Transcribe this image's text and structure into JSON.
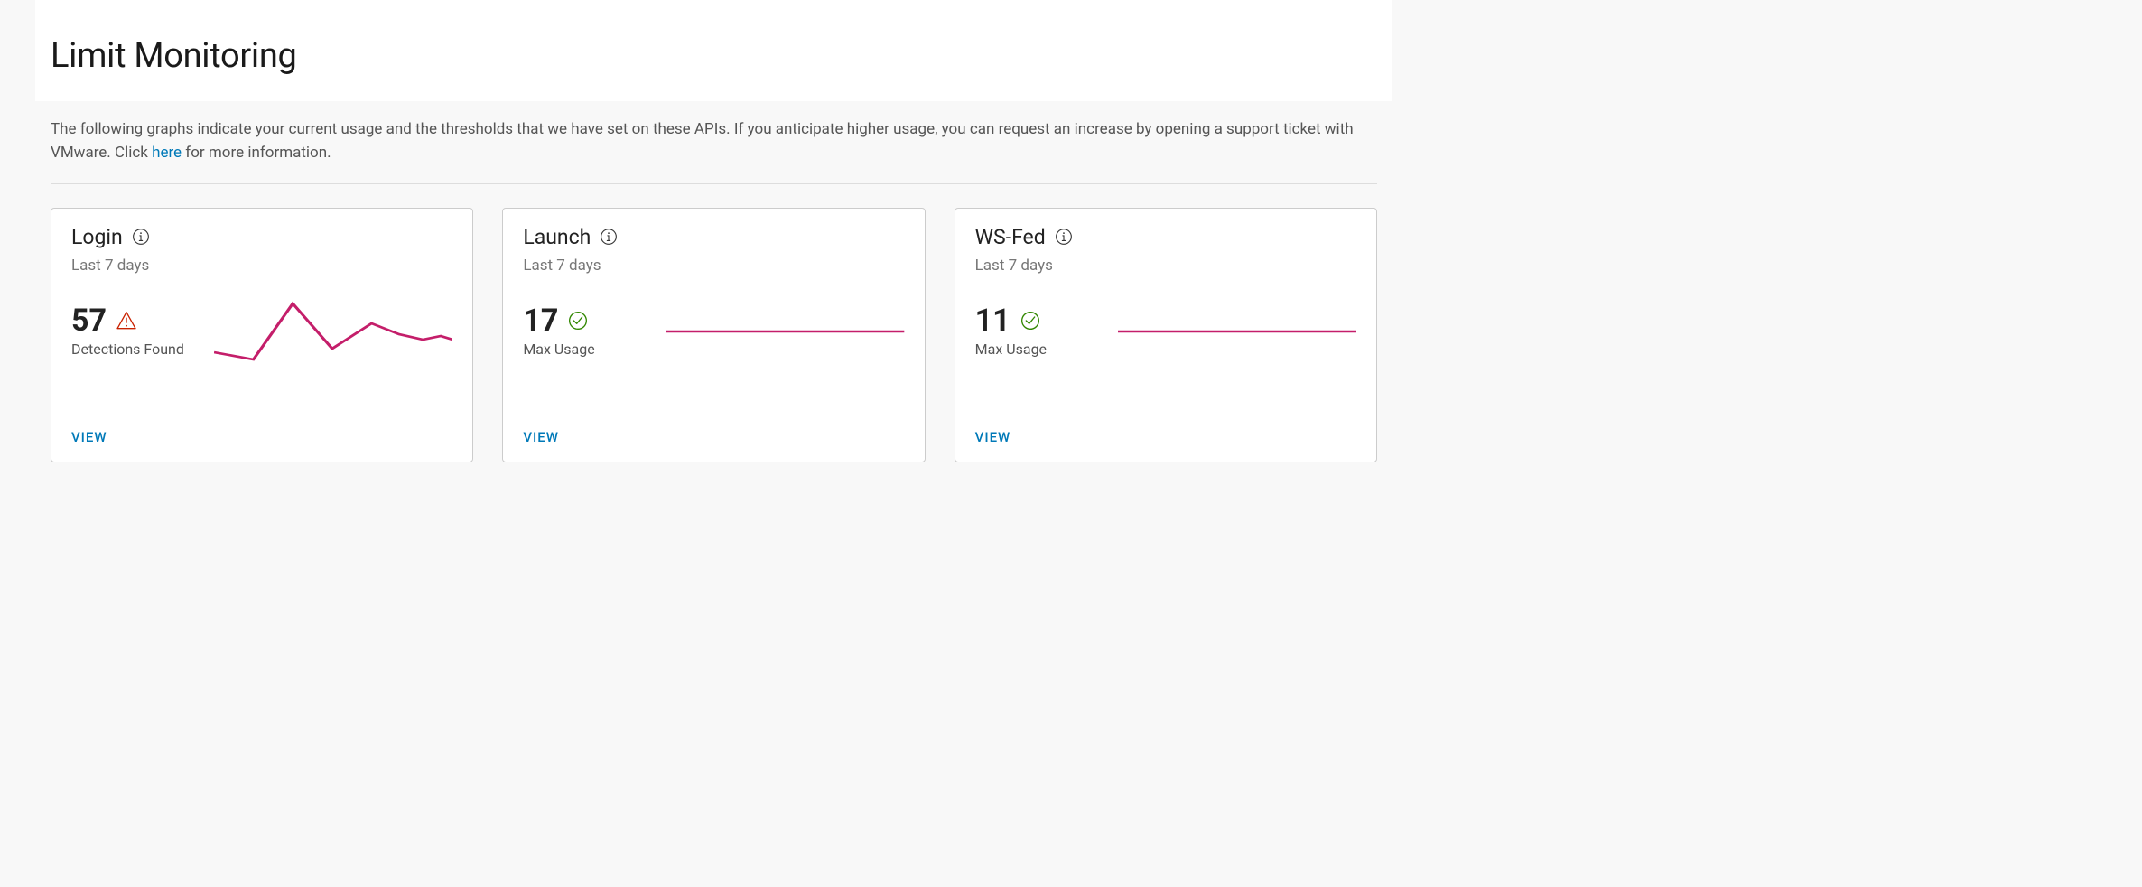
{
  "header": {
    "title": "Limit Monitoring",
    "intro_prefix": "The following graphs indicate your current usage and the thresholds that we have set on these APIs. If you anticipate higher usage, you can request an increase by opening a support ticket with VMware. Click ",
    "intro_link": "here",
    "intro_suffix": " for more information."
  },
  "cards": [
    {
      "title": "Login",
      "subtitle": "Last 7 days",
      "value": "57",
      "label": "Detections Found",
      "status": "warn",
      "view": "VIEW"
    },
    {
      "title": "Launch",
      "subtitle": "Last 7 days",
      "value": "17",
      "label": "Max Usage",
      "status": "ok",
      "view": "VIEW"
    },
    {
      "title": "WS-Fed",
      "subtitle": "Last 7 days",
      "value": "11",
      "label": "Max Usage",
      "status": "ok",
      "view": "VIEW"
    }
  ],
  "colors": {
    "spark_stroke": "#c41e6a"
  },
  "chart_data": [
    {
      "type": "line",
      "title": "Login",
      "x": [
        1,
        2,
        3,
        4,
        5,
        6,
        7
      ],
      "values": [
        38,
        30,
        80,
        40,
        57,
        45,
        42
      ],
      "subtitle": "Last 7 days",
      "ylabel": "Detections",
      "ylim": [
        0,
        100
      ]
    },
    {
      "type": "line",
      "title": "Launch",
      "x": [
        1,
        2,
        3,
        4,
        5,
        6,
        7
      ],
      "values": [
        17,
        17,
        17,
        17,
        17,
        17,
        17
      ],
      "subtitle": "Last 7 days",
      "ylabel": "Usage",
      "ylim": [
        0,
        100
      ]
    },
    {
      "type": "line",
      "title": "WS-Fed",
      "x": [
        1,
        2,
        3,
        4,
        5,
        6,
        7
      ],
      "values": [
        11,
        11,
        11,
        11,
        11,
        11,
        11
      ],
      "subtitle": "Last 7 days",
      "ylabel": "Usage",
      "ylim": [
        0,
        100
      ]
    }
  ]
}
